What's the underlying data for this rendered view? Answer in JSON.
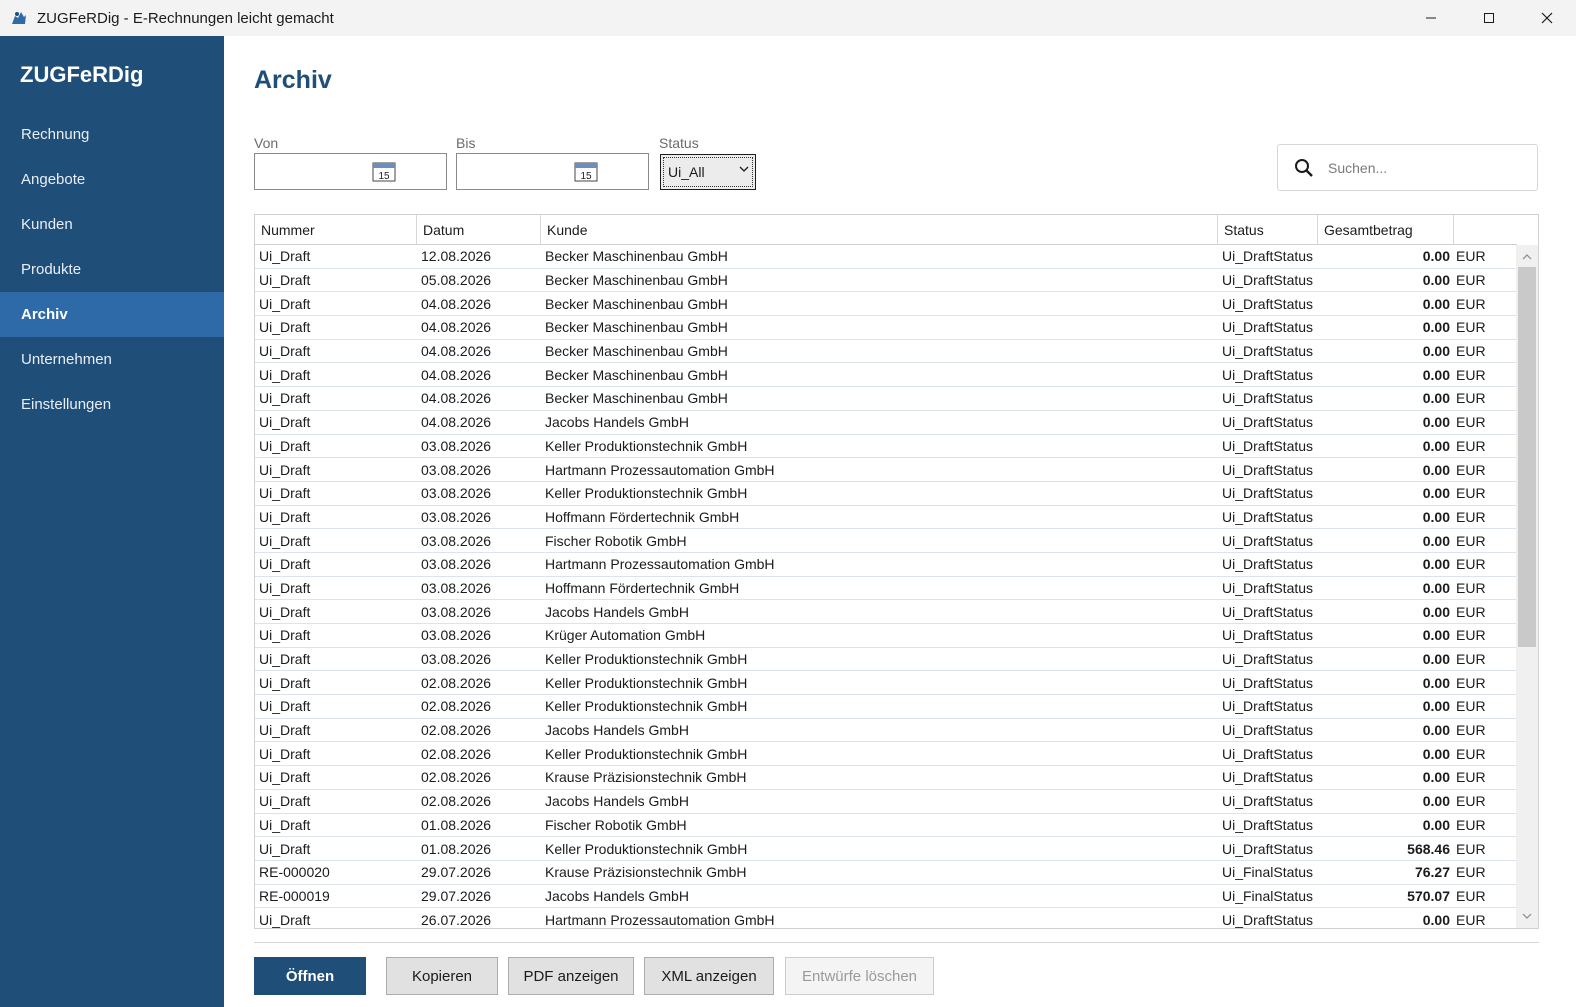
{
  "window": {
    "title": "ZUGFeRDig - E-Rechnungen leicht gemacht",
    "minimize_glyph": "—",
    "maximize_glyph": "☐",
    "close_glyph": "✕"
  },
  "sidebar": {
    "brand": "ZUGFeRDig",
    "items": [
      {
        "label": "Rechnung"
      },
      {
        "label": "Angebote"
      },
      {
        "label": "Kunden"
      },
      {
        "label": "Produkte"
      },
      {
        "label": "Archiv",
        "active": true
      },
      {
        "label": "Unternehmen"
      },
      {
        "label": "Einstellungen"
      }
    ]
  },
  "main": {
    "title": "Archiv",
    "filters": {
      "from_label": "Von",
      "to_label": "Bis",
      "status_label": "Status",
      "status_value": "Ui_All",
      "calendar_day": "15"
    },
    "search": {
      "placeholder": "Suchen..."
    },
    "table": {
      "columns": [
        "Nummer",
        "Datum",
        "Kunde",
        "Status",
        "Gesamtbetrag"
      ],
      "rows": [
        [
          "Ui_Draft",
          "12.08.2026",
          "Becker Maschinenbau GmbH",
          "Ui_DraftStatus",
          "0.00",
          "EUR"
        ],
        [
          "Ui_Draft",
          "05.08.2026",
          "Becker Maschinenbau GmbH",
          "Ui_DraftStatus",
          "0.00",
          "EUR"
        ],
        [
          "Ui_Draft",
          "04.08.2026",
          "Becker Maschinenbau GmbH",
          "Ui_DraftStatus",
          "0.00",
          "EUR"
        ],
        [
          "Ui_Draft",
          "04.08.2026",
          "Becker Maschinenbau GmbH",
          "Ui_DraftStatus",
          "0.00",
          "EUR"
        ],
        [
          "Ui_Draft",
          "04.08.2026",
          "Becker Maschinenbau GmbH",
          "Ui_DraftStatus",
          "0.00",
          "EUR"
        ],
        [
          "Ui_Draft",
          "04.08.2026",
          "Becker Maschinenbau GmbH",
          "Ui_DraftStatus",
          "0.00",
          "EUR"
        ],
        [
          "Ui_Draft",
          "04.08.2026",
          "Becker Maschinenbau GmbH",
          "Ui_DraftStatus",
          "0.00",
          "EUR"
        ],
        [
          "Ui_Draft",
          "04.08.2026",
          "Jacobs Handels GmbH",
          "Ui_DraftStatus",
          "0.00",
          "EUR"
        ],
        [
          "Ui_Draft",
          "03.08.2026",
          "Keller Produktionstechnik GmbH",
          "Ui_DraftStatus",
          "0.00",
          "EUR"
        ],
        [
          "Ui_Draft",
          "03.08.2026",
          "Hartmann Prozessautomation GmbH",
          "Ui_DraftStatus",
          "0.00",
          "EUR"
        ],
        [
          "Ui_Draft",
          "03.08.2026",
          "Keller Produktionstechnik GmbH",
          "Ui_DraftStatus",
          "0.00",
          "EUR"
        ],
        [
          "Ui_Draft",
          "03.08.2026",
          "Hoffmann Fördertechnik GmbH",
          "Ui_DraftStatus",
          "0.00",
          "EUR"
        ],
        [
          "Ui_Draft",
          "03.08.2026",
          "Fischer Robotik GmbH",
          "Ui_DraftStatus",
          "0.00",
          "EUR"
        ],
        [
          "Ui_Draft",
          "03.08.2026",
          "Hartmann Prozessautomation GmbH",
          "Ui_DraftStatus",
          "0.00",
          "EUR"
        ],
        [
          "Ui_Draft",
          "03.08.2026",
          "Hoffmann Fördertechnik GmbH",
          "Ui_DraftStatus",
          "0.00",
          "EUR"
        ],
        [
          "Ui_Draft",
          "03.08.2026",
          "Jacobs Handels GmbH",
          "Ui_DraftStatus",
          "0.00",
          "EUR"
        ],
        [
          "Ui_Draft",
          "03.08.2026",
          "Krüger Automation GmbH",
          "Ui_DraftStatus",
          "0.00",
          "EUR"
        ],
        [
          "Ui_Draft",
          "03.08.2026",
          "Keller Produktionstechnik GmbH",
          "Ui_DraftStatus",
          "0.00",
          "EUR"
        ],
        [
          "Ui_Draft",
          "02.08.2026",
          "Keller Produktionstechnik GmbH",
          "Ui_DraftStatus",
          "0.00",
          "EUR"
        ],
        [
          "Ui_Draft",
          "02.08.2026",
          "Keller Produktionstechnik GmbH",
          "Ui_DraftStatus",
          "0.00",
          "EUR"
        ],
        [
          "Ui_Draft",
          "02.08.2026",
          "Jacobs Handels GmbH",
          "Ui_DraftStatus",
          "0.00",
          "EUR"
        ],
        [
          "Ui_Draft",
          "02.08.2026",
          "Keller Produktionstechnik GmbH",
          "Ui_DraftStatus",
          "0.00",
          "EUR"
        ],
        [
          "Ui_Draft",
          "02.08.2026",
          "Krause Präzisionstechnik GmbH",
          "Ui_DraftStatus",
          "0.00",
          "EUR"
        ],
        [
          "Ui_Draft",
          "02.08.2026",
          "Jacobs Handels GmbH",
          "Ui_DraftStatus",
          "0.00",
          "EUR"
        ],
        [
          "Ui_Draft",
          "01.08.2026",
          "Fischer Robotik GmbH",
          "Ui_DraftStatus",
          "0.00",
          "EUR"
        ],
        [
          "Ui_Draft",
          "01.08.2026",
          "Keller Produktionstechnik GmbH",
          "Ui_DraftStatus",
          "568.46",
          "EUR"
        ],
        [
          "RE-000020",
          "29.07.2026",
          "Krause Präzisionstechnik GmbH",
          "Ui_FinalStatus",
          "76.27",
          "EUR"
        ],
        [
          "RE-000019",
          "29.07.2026",
          "Jacobs Handels GmbH",
          "Ui_FinalStatus",
          "570.07",
          "EUR"
        ],
        [
          "Ui_Draft",
          "26.07.2026",
          "Hartmann Prozessautomation GmbH",
          "Ui_DraftStatus",
          "0.00",
          "EUR"
        ]
      ]
    },
    "buttons": {
      "open": "Öffnen",
      "copy": "Kopieren",
      "pdf": "PDF anzeigen",
      "xml": "XML anzeigen",
      "delete_drafts": "Entwürfe löschen"
    }
  },
  "colors": {
    "sidebar_bg": "#1f4e79",
    "sidebar_active": "#2f6aa8",
    "accent": "#1f4e79"
  }
}
